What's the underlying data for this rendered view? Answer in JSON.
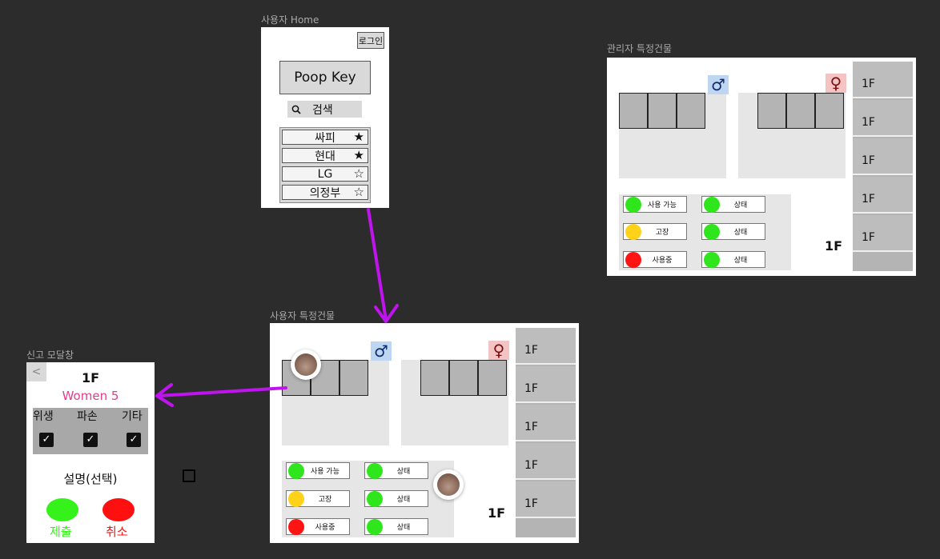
{
  "frames": {
    "home_label": "사용자 Home",
    "admin_label": "관리자 특정건물",
    "user_label": "사용자 특정건물",
    "modal_label": "신고 모달창"
  },
  "home": {
    "login_label": "로그인",
    "main_button_label": "Poop Key",
    "search_label": "검색",
    "search_icon": "search-icon",
    "favorites": [
      {
        "name": "싸피",
        "starred": true
      },
      {
        "name": "현대",
        "starred": true
      },
      {
        "name": "LG",
        "starred": false
      },
      {
        "name": "의정부",
        "starred": false
      }
    ]
  },
  "building": {
    "male_symbol": "♂",
    "female_symbol": "♀",
    "current_floor": "1F",
    "floors": [
      "1F",
      "1F",
      "1F",
      "1F",
      "1F"
    ],
    "legend": [
      {
        "label": "사용 가능",
        "color": "#2fe51b"
      },
      {
        "label": "고장",
        "color": "#ffd21a"
      },
      {
        "label": "사용중",
        "color": "#ff1414"
      }
    ],
    "status": [
      {
        "label": "상태",
        "color": "#2fe51b"
      },
      {
        "label": "상태",
        "color": "#2fe51b"
      },
      {
        "label": "상태",
        "color": "#2fe51b"
      }
    ]
  },
  "modal": {
    "back_symbol": "<",
    "floor": "1F",
    "room": "Women 5",
    "categories": [
      "위생",
      "파손",
      "기타"
    ],
    "checked": [
      true,
      true,
      true
    ],
    "description": "설명(선택)",
    "submit_label": "제출",
    "cancel_label": "취소",
    "colors": {
      "room": "#e63b8c",
      "submit": "#35f21a",
      "cancel": "#ff1010"
    }
  },
  "colors": {
    "canvas": "#2c2c2c",
    "arrow": "#c014ee"
  }
}
